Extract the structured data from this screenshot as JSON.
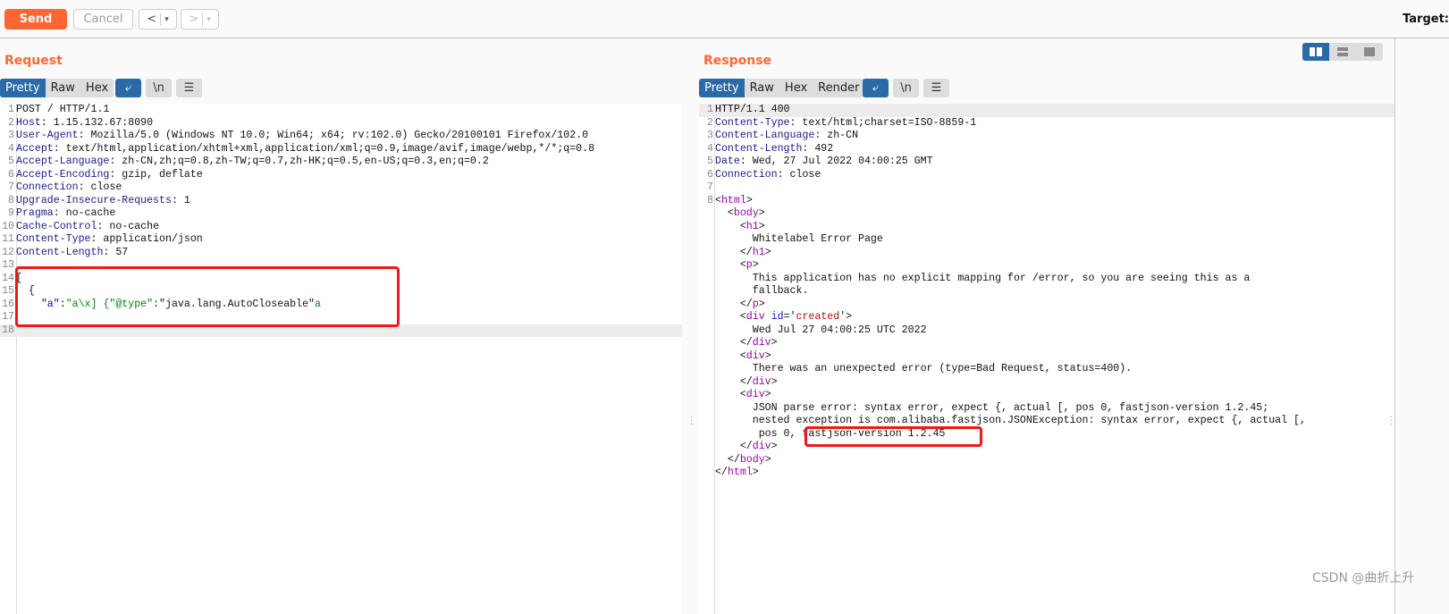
{
  "toolbar": {
    "send": "Send",
    "cancel": "Cancel",
    "back": "<",
    "forward": ">",
    "dropdown": "▾",
    "target_label": "Target:"
  },
  "request": {
    "title": "Request",
    "tabs": [
      "Pretty",
      "Raw",
      "Hex"
    ],
    "active_tab": "Pretty",
    "buttons": {
      "wrap": "⤶",
      "newline": "\\n",
      "menu": "☰"
    },
    "lines": [
      [
        {
          "t": "POST / HTTP/1.1",
          "c": "plain"
        }
      ],
      [
        {
          "t": "Host",
          "c": "hname"
        },
        {
          "t": ": 1.15.132.67:8090",
          "c": "plain"
        }
      ],
      [
        {
          "t": "User-Agent",
          "c": "hname"
        },
        {
          "t": ": Mozilla/5.0 (Windows NT 10.0; Win64; x64; rv:102.0) Gecko/20100101 Firefox/102.0",
          "c": "plain"
        }
      ],
      [
        {
          "t": "Accept",
          "c": "hname"
        },
        {
          "t": ": text/html,application/xhtml+xml,application/xml;q=0.9,image/avif,image/webp,*/*;q=0.8",
          "c": "plain"
        }
      ],
      [
        {
          "t": "Accept-Language",
          "c": "hname"
        },
        {
          "t": ": zh-CN,zh;q=0.8,zh-TW;q=0.7,zh-HK;q=0.5,en-US;q=0.3,en;q=0.2",
          "c": "plain"
        }
      ],
      [
        {
          "t": "Accept-Encoding",
          "c": "hname"
        },
        {
          "t": ": gzip, deflate",
          "c": "plain"
        }
      ],
      [
        {
          "t": "Connection",
          "c": "hname"
        },
        {
          "t": ": close",
          "c": "plain"
        }
      ],
      [
        {
          "t": "Upgrade-Insecure-Requests",
          "c": "hname"
        },
        {
          "t": ": 1",
          "c": "plain"
        }
      ],
      [
        {
          "t": "Pragma",
          "c": "hname"
        },
        {
          "t": ": no-cache",
          "c": "plain"
        }
      ],
      [
        {
          "t": "Cache-Control",
          "c": "hname"
        },
        {
          "t": ": no-cache",
          "c": "plain"
        }
      ],
      [
        {
          "t": "Content-Type",
          "c": "hname"
        },
        {
          "t": ": application/json",
          "c": "plain"
        }
      ],
      [
        {
          "t": "Content-Length",
          "c": "hname"
        },
        {
          "t": ": 57",
          "c": "plain"
        }
      ],
      [],
      [
        {
          "t": "[",
          "c": "plain"
        }
      ],
      [
        {
          "t": "  {",
          "c": "plain"
        }
      ],
      [
        {
          "t": "    ",
          "c": "plain"
        },
        {
          "t": "\"a\"",
          "c": "key"
        },
        {
          "t": ":",
          "c": "plain"
        },
        {
          "t": "\"a\\x] {\"@type\"",
          "c": "str"
        },
        {
          "t": ":\"java.lang.AutoCloseable\"",
          "c": "plain"
        },
        {
          "t": "a",
          "c": "str"
        }
      ],
      [],
      []
    ]
  },
  "response": {
    "title": "Response",
    "tabs": [
      "Pretty",
      "Raw",
      "Hex",
      "Render"
    ],
    "active_tab": "Pretty",
    "buttons": {
      "wrap": "⤶",
      "newline": "\\n",
      "menu": "☰"
    },
    "lines": [
      {
        "n": "1",
        "p": [
          {
            "t": "HTTP/1.1 400",
            "c": "plain"
          }
        ]
      },
      {
        "n": "2",
        "p": [
          {
            "t": "Content-Type",
            "c": "hname"
          },
          {
            "t": ": text/html;charset=ISO-8859-1",
            "c": "plain"
          }
        ]
      },
      {
        "n": "3",
        "p": [
          {
            "t": "Content-Language",
            "c": "hname"
          },
          {
            "t": ": zh-CN",
            "c": "plain"
          }
        ]
      },
      {
        "n": "4",
        "p": [
          {
            "t": "Content-Length",
            "c": "hname"
          },
          {
            "t": ": 492",
            "c": "plain"
          }
        ]
      },
      {
        "n": "5",
        "p": [
          {
            "t": "Date",
            "c": "hname"
          },
          {
            "t": ": Wed, 27 Jul 2022 04:00:25 GMT",
            "c": "plain"
          }
        ]
      },
      {
        "n": "6",
        "p": [
          {
            "t": "Connection",
            "c": "hname"
          },
          {
            "t": ": close",
            "c": "plain"
          }
        ]
      },
      {
        "n": "7",
        "p": []
      },
      {
        "n": "8",
        "p": [
          {
            "t": "<",
            "c": "plain"
          },
          {
            "t": "html",
            "c": "tag"
          },
          {
            "t": ">",
            "c": "plain"
          }
        ]
      },
      {
        "n": "",
        "p": [
          {
            "t": "  <",
            "c": "plain"
          },
          {
            "t": "body",
            "c": "tag"
          },
          {
            "t": ">",
            "c": "plain"
          }
        ]
      },
      {
        "n": "",
        "p": [
          {
            "t": "    <",
            "c": "plain"
          },
          {
            "t": "h1",
            "c": "tag"
          },
          {
            "t": ">",
            "c": "plain"
          }
        ]
      },
      {
        "n": "",
        "p": [
          {
            "t": "      Whitelabel Error Page",
            "c": "plain"
          }
        ]
      },
      {
        "n": "",
        "p": [
          {
            "t": "    </",
            "c": "plain"
          },
          {
            "t": "h1",
            "c": "tag"
          },
          {
            "t": ">",
            "c": "plain"
          }
        ]
      },
      {
        "n": "",
        "p": [
          {
            "t": "    <",
            "c": "plain"
          },
          {
            "t": "p",
            "c": "tag"
          },
          {
            "t": ">",
            "c": "plain"
          }
        ]
      },
      {
        "n": "",
        "p": [
          {
            "t": "      This application has no explicit mapping for /error, so you are seeing this as a",
            "c": "plain"
          }
        ]
      },
      {
        "n": "",
        "p": [
          {
            "t": "      fallback.",
            "c": "plain"
          }
        ]
      },
      {
        "n": "",
        "p": [
          {
            "t": "    </",
            "c": "plain"
          },
          {
            "t": "p",
            "c": "tag"
          },
          {
            "t": ">",
            "c": "plain"
          }
        ]
      },
      {
        "n": "",
        "p": [
          {
            "t": "    <",
            "c": "plain"
          },
          {
            "t": "div",
            "c": "tag"
          },
          {
            "t": " ",
            "c": "plain"
          },
          {
            "t": "id",
            "c": "attr"
          },
          {
            "t": "='",
            "c": "plain"
          },
          {
            "t": "created",
            "c": "val"
          },
          {
            "t": "'>",
            "c": "plain"
          }
        ]
      },
      {
        "n": "",
        "p": [
          {
            "t": "      Wed Jul 27 04:00:25 UTC 2022",
            "c": "plain"
          }
        ]
      },
      {
        "n": "",
        "p": [
          {
            "t": "    </",
            "c": "plain"
          },
          {
            "t": "div",
            "c": "tag"
          },
          {
            "t": ">",
            "c": "plain"
          }
        ]
      },
      {
        "n": "",
        "p": [
          {
            "t": "    <",
            "c": "plain"
          },
          {
            "t": "div",
            "c": "tag"
          },
          {
            "t": ">",
            "c": "plain"
          }
        ]
      },
      {
        "n": "",
        "p": [
          {
            "t": "      There was an unexpected error (type=Bad Request, status=400).",
            "c": "plain"
          }
        ]
      },
      {
        "n": "",
        "p": [
          {
            "t": "    </",
            "c": "plain"
          },
          {
            "t": "div",
            "c": "tag"
          },
          {
            "t": ">",
            "c": "plain"
          }
        ]
      },
      {
        "n": "",
        "p": [
          {
            "t": "    <",
            "c": "plain"
          },
          {
            "t": "div",
            "c": "tag"
          },
          {
            "t": ">",
            "c": "plain"
          }
        ]
      },
      {
        "n": "",
        "p": [
          {
            "t": "      JSON parse error: syntax error, expect {, actual [, pos 0, fastjson-version 1.2.45;",
            "c": "plain"
          }
        ]
      },
      {
        "n": "",
        "p": [
          {
            "t": "      nested exception is com.alibaba.fastjson.JSONException: syntax error, expect {, actual [,",
            "c": "plain"
          }
        ]
      },
      {
        "n": "",
        "p": [
          {
            "t": "       pos 0, fastjson-version 1.2.45",
            "c": "plain"
          }
        ]
      },
      {
        "n": "",
        "p": [
          {
            "t": "    </",
            "c": "plain"
          },
          {
            "t": "div",
            "c": "tag"
          },
          {
            "t": ">",
            "c": "plain"
          }
        ]
      },
      {
        "n": "",
        "p": [
          {
            "t": "  </",
            "c": "plain"
          },
          {
            "t": "body",
            "c": "tag"
          },
          {
            "t": ">",
            "c": "plain"
          }
        ]
      },
      {
        "n": "",
        "p": [
          {
            "t": "</",
            "c": "plain"
          },
          {
            "t": "html",
            "c": "tag"
          },
          {
            "t": ">",
            "c": "plain"
          }
        ]
      }
    ]
  },
  "layout_toggle": {
    "active": "side-by-side"
  },
  "watermark": "CSDN @曲折上升",
  "colors": {
    "accent": "#ff6633",
    "active_tab": "#2a6aa8",
    "highlight_box": "#f01818"
  }
}
